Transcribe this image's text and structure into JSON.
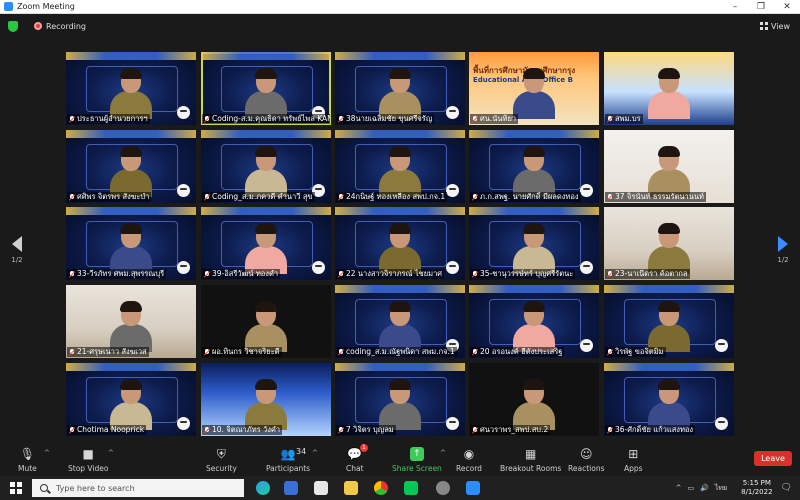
{
  "window": {
    "title": "Zoom Meeting"
  },
  "topbar": {
    "recording_label": "Recording",
    "view_label": "View"
  },
  "gallery": {
    "page_indicator_left": "1/2",
    "page_indicator_right": "1/2",
    "tiles": [
      {
        "name": "ประธานผู้อำนวยการฯ",
        "pattern": "tech",
        "muted": true,
        "mascot": true
      },
      {
        "name": "Coding-ส.ม.คุณธิดา ทรัพย์ไพล KAN1",
        "pattern": "tech",
        "muted": true,
        "mascot": true,
        "active": true
      },
      {
        "name": "38นายเฉลิมชัย ขุนศรีจรัญ",
        "pattern": "tech",
        "muted": true,
        "mascot": true
      },
      {
        "name": "ศน.นันทิยา",
        "pattern": "banner-orange",
        "muted": true,
        "banner_line1": "พื้นที่การศึกษามัธยมศึกษากรุง",
        "banner_line2": "Educational Area Office B"
      },
      {
        "name": "สพม.บร",
        "pattern": "orange2",
        "muted": true
      },
      {
        "name": "ศศิพร จิตรพร สังฆะบำ",
        "pattern": "tech",
        "muted": true,
        "mascot": true
      },
      {
        "name": "Coding_ส.ม.ภควดี คำนาวี สุข",
        "pattern": "tech",
        "muted": true,
        "mascot": true
      },
      {
        "name": "24กนิษฐ์ ทองเหลือง สพป.กจ.1",
        "pattern": "tech",
        "muted": true,
        "mascot": true
      },
      {
        "name": "ภ.ก.สพฐ. นายศักดิ์ มีผลดงทอง",
        "pattern": "tech",
        "muted": true,
        "mascot": true
      },
      {
        "name": "37 จิรนันท์ ธรรมรัตนานนท์",
        "pattern": "office",
        "muted": true
      },
      {
        "name": "33-วีรภัทร ศพม.สุพรรณบุรี",
        "pattern": "tech",
        "muted": true,
        "mascot": true
      },
      {
        "name": "39-อิสรีวัฒน์ ทองดำ",
        "pattern": "tech",
        "muted": true,
        "mascot": true
      },
      {
        "name": "22 นางสาวจิราภรณ์ ไชยมาศ",
        "pattern": "tech",
        "muted": true,
        "mascot": true
      },
      {
        "name": "35-ชานุวรรษ์ทร์ บุญศรีรัตนะ",
        "pattern": "tech",
        "muted": true,
        "mascot": true
      },
      {
        "name": "23-นาเนีดรา ค้อตากล",
        "pattern": "room",
        "muted": true
      },
      {
        "name": "21-ศรุษเนาว สังฆเวส",
        "pattern": "room",
        "muted": true
      },
      {
        "name": "ผอ.ทินกร วิชาจริยะดี",
        "pattern": "dark",
        "muted": true
      },
      {
        "name": "coding_ส.ม.ณัฐพนิดา สพม.กจ.1",
        "pattern": "tech",
        "muted": true,
        "mascot": true
      },
      {
        "name": "20 อรอนงค์ ฮีตังประเสริฐ",
        "pattern": "tech",
        "muted": true,
        "mascot": true
      },
      {
        "name": "วิรพัฐ ขอจิตมิม",
        "pattern": "tech",
        "muted": true,
        "mascot": true
      },
      {
        "name": "Chotima Nooprick",
        "pattern": "tech",
        "muted": true,
        "mascot": true
      },
      {
        "name": "10. จิตณาภัทร วังคำ",
        "pattern": "banner",
        "muted": true
      },
      {
        "name": "7 วิจิตร บุญลม",
        "pattern": "tech",
        "muted": true,
        "mascot": true
      },
      {
        "name": "ศนวราพร_สพป.สบ.2",
        "pattern": "dark",
        "muted": true
      },
      {
        "name": "36-ศักดิ์ชัย แก้วแสงทอง",
        "pattern": "tech",
        "muted": true,
        "mascot": true
      }
    ]
  },
  "toolbar": {
    "mute": "Mute",
    "stop_video": "Stop Video",
    "security": "Security",
    "participants": "Participants",
    "participants_count": "34",
    "chat": "Chat",
    "chat_badge": "1",
    "share_screen": "Share Screen",
    "record": "Record",
    "breakout_rooms": "Breakout Rooms",
    "reactions": "Reactions",
    "apps": "Apps",
    "leave": "Leave"
  },
  "taskbar": {
    "search_placeholder": "Type here to search",
    "language": "ไทย",
    "time": "5:15 PM",
    "date": "8/1/2022"
  },
  "colors": {
    "accent_green": "#3ecb5a",
    "leave_red": "#d9302c",
    "active_speaker": "#c8d84a",
    "nav_blue": "#3a8dff"
  }
}
